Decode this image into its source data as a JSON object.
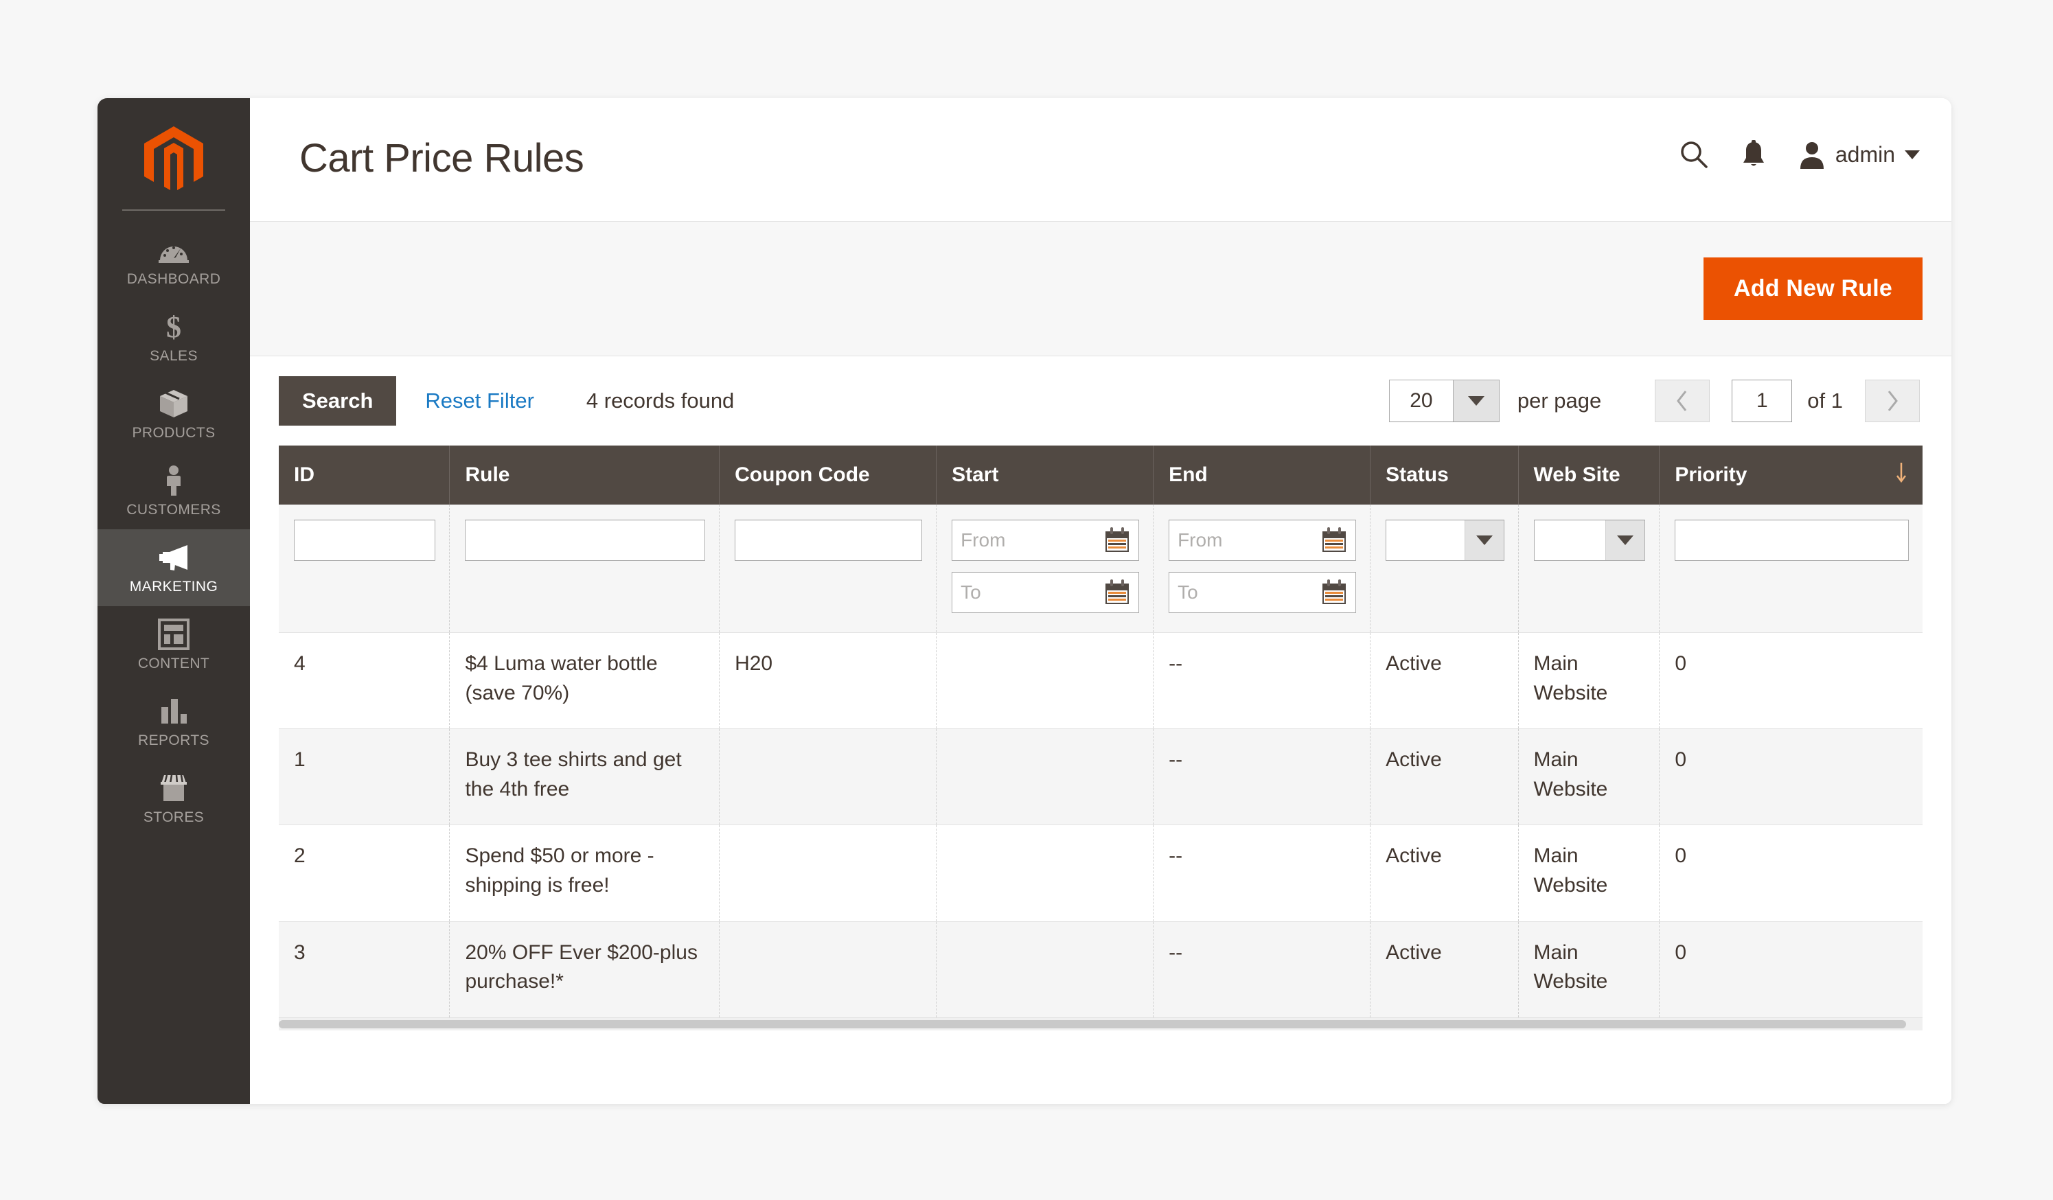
{
  "sidebar": {
    "logo_name": "magento-logo",
    "items": [
      {
        "label": "DASHBOARD",
        "icon": "dashboard-gauge-icon",
        "active": false
      },
      {
        "label": "SALES",
        "icon": "dollar-sign-icon",
        "active": false
      },
      {
        "label": "PRODUCTS",
        "icon": "box-icon",
        "active": false
      },
      {
        "label": "CUSTOMERS",
        "icon": "person-icon",
        "active": false
      },
      {
        "label": "MARKETING",
        "icon": "megaphone-icon",
        "active": true
      },
      {
        "label": "CONTENT",
        "icon": "layout-icon",
        "active": false
      },
      {
        "label": "REPORTS",
        "icon": "bar-chart-icon",
        "active": false
      },
      {
        "label": "STORES",
        "icon": "storefront-icon",
        "active": false
      }
    ]
  },
  "header": {
    "title": "Cart Price Rules",
    "search_icon": "search-icon",
    "notifications_icon": "bell-icon",
    "avatar_icon": "user-avatar-icon",
    "admin_name": "admin"
  },
  "action_bar": {
    "add_new_rule_label": "Add New Rule",
    "accent_color": "#eb5202"
  },
  "toolbar": {
    "search_label": "Search",
    "reset_filter_label": "Reset Filter",
    "records_found": "4 records found",
    "per_page_value": "20",
    "per_page_label": "per page",
    "page_value": "1",
    "of_pages_label": "of 1",
    "prev_icon": "chevron-left-icon",
    "next_icon": "chevron-right-icon"
  },
  "grid": {
    "columns": [
      {
        "key": "id",
        "label": "ID"
      },
      {
        "key": "rule",
        "label": "Rule"
      },
      {
        "key": "coupon_code",
        "label": "Coupon Code"
      },
      {
        "key": "start",
        "label": "Start"
      },
      {
        "key": "end",
        "label": "End"
      },
      {
        "key": "status",
        "label": "Status"
      },
      {
        "key": "web_site",
        "label": "Web Site"
      },
      {
        "key": "priority",
        "label": "Priority"
      }
    ],
    "sorted_column": "priority",
    "sort_direction_icon": "arrow-down-icon",
    "filters": {
      "id": "",
      "rule": "",
      "coupon_code": "",
      "start_from_placeholder": "From",
      "start_to_placeholder": "To",
      "end_from_placeholder": "From",
      "end_to_placeholder": "To",
      "status": "",
      "web_site": "",
      "priority": "",
      "calendar_icon": "calendar-icon"
    },
    "rows": [
      {
        "id": "4",
        "rule": "$4 Luma water bottle (save 70%)",
        "coupon_code": "H20",
        "start": "",
        "end": "--",
        "status": "Active",
        "web_site": "Main Website",
        "priority": "0"
      },
      {
        "id": "1",
        "rule": "Buy 3 tee shirts and get the 4th free",
        "coupon_code": "",
        "start": "",
        "end": "--",
        "status": "Active",
        "web_site": "Main Website",
        "priority": "0"
      },
      {
        "id": "2",
        "rule": "Spend $50 or more - shipping is free!",
        "coupon_code": "",
        "start": "",
        "end": "--",
        "status": "Active",
        "web_site": "Main Website",
        "priority": "0"
      },
      {
        "id": "3",
        "rule": "20% OFF Ever $200-plus purchase!*",
        "coupon_code": "",
        "start": "",
        "end": "--",
        "status": "Active",
        "web_site": "Main Website",
        "priority": "0"
      }
    ]
  }
}
